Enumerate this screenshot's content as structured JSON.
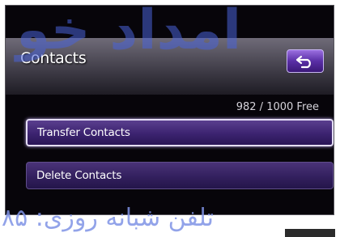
{
  "header": {
    "title": "Contacts",
    "back_icon": "back-arrow-icon"
  },
  "status": {
    "free_count": "982 / 1000 Free"
  },
  "menu": {
    "items": [
      {
        "label": "Transfer Contacts",
        "selected": true
      },
      {
        "label": "Delete Contacts",
        "selected": false
      }
    ]
  },
  "watermark": {
    "brand": "امداد خو",
    "phone": "تلفن شبانه روزی: ۸۵"
  },
  "colors": {
    "screen_bg": "#07050a",
    "accent": "#5a2fa6",
    "selected_border": "#e4ddf5",
    "watermark": "#4a63d8"
  }
}
